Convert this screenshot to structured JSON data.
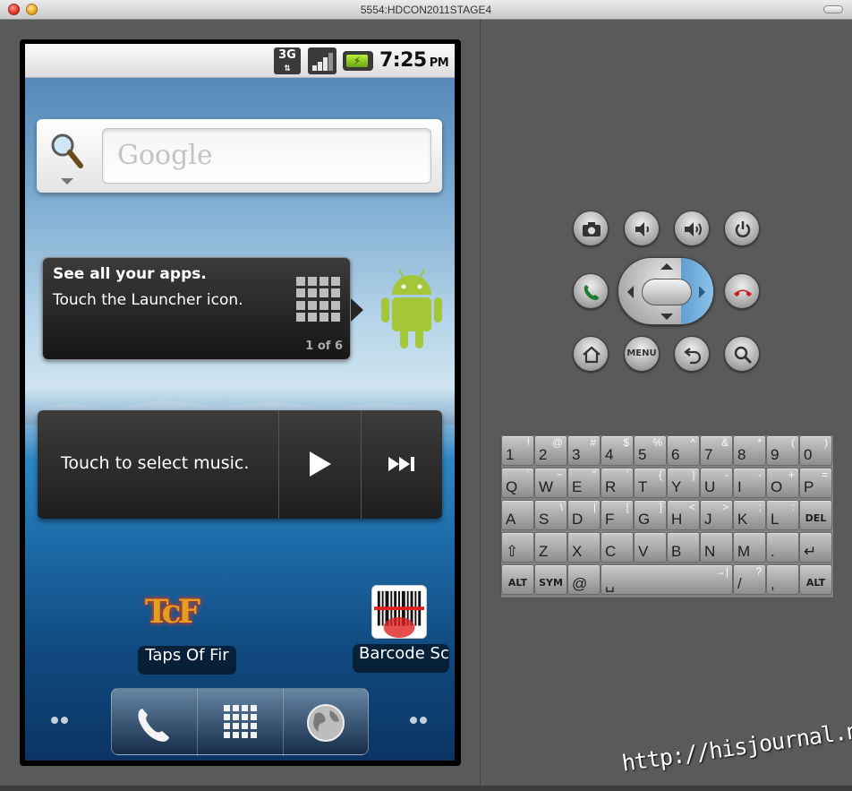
{
  "window": {
    "title": "5554:HDCON2011STAGE4"
  },
  "statusbar": {
    "network": "3G",
    "time": "7:25",
    "ampm": "PM"
  },
  "search": {
    "placeholder": "Google"
  },
  "tip": {
    "title": "See all your apps.",
    "text": "Touch the Launcher icon.",
    "page": "1 of 6"
  },
  "music": {
    "label": "Touch to select music."
  },
  "apps": [
    {
      "label": "Taps Of Fir",
      "icon_text": "TcF"
    },
    {
      "label": "Barcode Sc",
      "icon": "barcode-scanner-icon"
    }
  ],
  "dock": {
    "items": [
      "phone-icon",
      "launcher-grid-icon",
      "browser-globe-icon"
    ]
  },
  "controls": {
    "top_row": [
      "camera-icon",
      "volume-down-icon",
      "volume-up-icon",
      "power-icon"
    ],
    "mid_row": [
      "call-icon",
      "dpad",
      "end-call-icon"
    ],
    "bottom_row": [
      "home-icon",
      "MENU",
      "back-icon",
      "search-icon"
    ],
    "menu_label": "MENU"
  },
  "keyboard": {
    "rows": [
      [
        [
          "1",
          "!"
        ],
        [
          "2",
          "@"
        ],
        [
          "3",
          "#"
        ],
        [
          "4",
          "$"
        ],
        [
          "5",
          "%"
        ],
        [
          "6",
          "^"
        ],
        [
          "7",
          "&"
        ],
        [
          "8",
          "*"
        ],
        [
          "9",
          "("
        ],
        [
          "0",
          ")"
        ]
      ],
      [
        [
          "Q",
          "`"
        ],
        [
          "W",
          "~"
        ],
        [
          "E",
          "\""
        ],
        [
          "R",
          "`"
        ],
        [
          "T",
          "{"
        ],
        [
          "Y",
          "}"
        ],
        [
          "U",
          "-"
        ],
        [
          "I",
          "-"
        ],
        [
          "O",
          "+"
        ],
        [
          "P",
          "="
        ]
      ],
      [
        [
          "A",
          ""
        ],
        [
          "S",
          "\\"
        ],
        [
          "D",
          "|"
        ],
        [
          "F",
          "["
        ],
        [
          "G",
          "]"
        ],
        [
          "H",
          "<"
        ],
        [
          "J",
          ">"
        ],
        [
          "K",
          ";"
        ],
        [
          "L",
          ":"
        ],
        [
          "DEL",
          ""
        ]
      ],
      [
        [
          "⇧",
          ""
        ],
        [
          "Z",
          ""
        ],
        [
          "X",
          ""
        ],
        [
          "C",
          ""
        ],
        [
          "V",
          ""
        ],
        [
          "B",
          ""
        ],
        [
          "N",
          ""
        ],
        [
          "M",
          ""
        ],
        [
          ".",
          ""
        ],
        [
          "↵",
          ""
        ]
      ],
      [
        [
          "ALT",
          ""
        ],
        [
          "SYM",
          ""
        ],
        [
          "@",
          ""
        ],
        [
          "␣",
          "→|"
        ],
        [
          "/",
          "?"
        ],
        [
          ",",
          ""
        ],
        [
          "ALT",
          ""
        ]
      ]
    ]
  },
  "watermark": "http://hisjournal.net"
}
